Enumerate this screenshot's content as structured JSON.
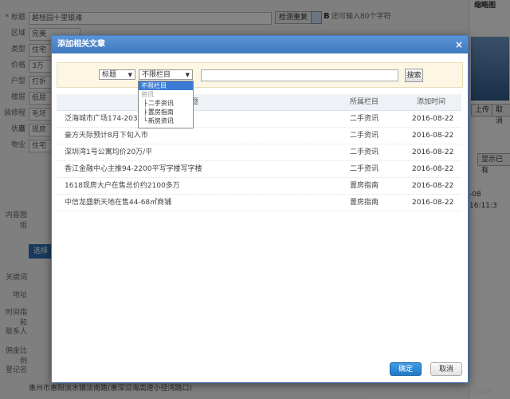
{
  "background": {
    "form_rows": [
      {
        "label": "* 标题",
        "value": "碧桂园十里银滩"
      },
      {
        "label": "区域",
        "value": "完美"
      },
      {
        "label": "类型",
        "value": "住宅"
      },
      {
        "label": "价格",
        "value": "3万"
      },
      {
        "label": "户型",
        "value": "打折"
      },
      {
        "label": "楼层",
        "value": "低层"
      },
      {
        "label": "装修程度",
        "value": "毛坯"
      },
      {
        "label": "状态",
        "value": "现房"
      },
      {
        "label": "物业",
        "value": "住宅"
      }
    ],
    "check_button": "检测重复",
    "char_hint": "还可输入80个字符",
    "thumb_label": "缩略图",
    "side_btn_1": "上传",
    "side_btn_2": "取消",
    "show_btn": "显示已有",
    "time_text": "-08 16:11:3",
    "content_label": "内容图组",
    "select_btn": "选择",
    "keyword_label": "关键词",
    "addr_label": "地址",
    "rest_labels": [
      "时间指和",
      "联系人",
      "佣金比例",
      "登记名"
    ],
    "addr_value": "惠州市惠阳淡水镇淡南路(惠深沿海高速小径湾路口)"
  },
  "dialog": {
    "title": "添加相关文章",
    "close_icon": "×",
    "search": {
      "field_select": "标题",
      "category_select": "不限栏目",
      "button": "搜索"
    },
    "dropdown": {
      "items": [
        {
          "label": "不限栏目",
          "type": "selected"
        },
        {
          "label": "资讯",
          "type": "group"
        },
        {
          "label": "二手资讯",
          "type": "sub"
        },
        {
          "label": "置房指南",
          "type": "sub"
        },
        {
          "label": "新房资讯",
          "type": "sub"
        }
      ]
    },
    "table": {
      "headers": {
        "title": "标题",
        "category": "所属栏目",
        "date": "添加时间"
      },
      "rows": [
        {
          "title": "泛海城市广场174-203㎡",
          "category": "二手资讯",
          "date": "2016-08-22"
        },
        {
          "title": "豪方天际预计8月下旬入市",
          "category": "二手资讯",
          "date": "2016-08-22"
        },
        {
          "title": "深圳湾1号公寓均价20万/平",
          "category": "二手资讯",
          "date": "2016-08-22"
        },
        {
          "title": "香江金融中心主推94-2200平写字楼写字楼",
          "category": "二手资讯",
          "date": "2016-08-22"
        },
        {
          "title": "1618现房大户在售总价约2100多万",
          "category": "置房指南",
          "date": "2016-08-22"
        },
        {
          "title": "中信龙盛新天地在售44-68㎡商铺",
          "category": "置房指南",
          "date": "2016-08-22"
        }
      ]
    },
    "footer": {
      "ok": "确定",
      "cancel": "取消"
    }
  },
  "watermark": "http://blog.csdn.net/u014617119",
  "colors": {
    "header": "#4a86cc",
    "accent": "#2a80cc",
    "search_bg": "#fdf6e3"
  }
}
